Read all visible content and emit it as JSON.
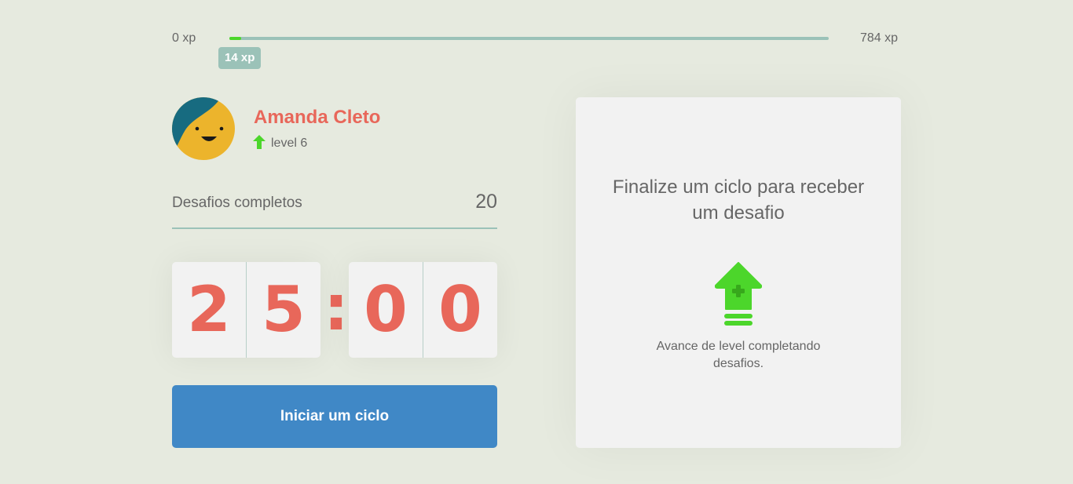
{
  "experience": {
    "min_label": "0 xp",
    "max_label": "784 xp",
    "current_label": "14 xp",
    "current": 14,
    "max": 784,
    "fill_color": "#4cd62b",
    "track_color": "#9bc2b8"
  },
  "profile": {
    "name": "Amanda Cleto",
    "level_label": "level 6",
    "avatar_icon": "smiley-avatar-icon",
    "level_icon": "arrow-up-icon"
  },
  "challenges": {
    "completed_label": "Desafios completos",
    "completed_value": "20"
  },
  "countdown": {
    "minute_left": "2",
    "minute_right": "5",
    "separator": ":",
    "second_left": "0",
    "second_right": "0",
    "digit_color": "#e8675a"
  },
  "start_button": {
    "label": "Iniciar um ciclo",
    "color": "#4088c6"
  },
  "challenge_box": {
    "title": "Finalize um ciclo para receber um desafio",
    "hint": "Avance de level completando desafios.",
    "icon": "level-up-icon",
    "icon_color": "#4cd62b"
  }
}
